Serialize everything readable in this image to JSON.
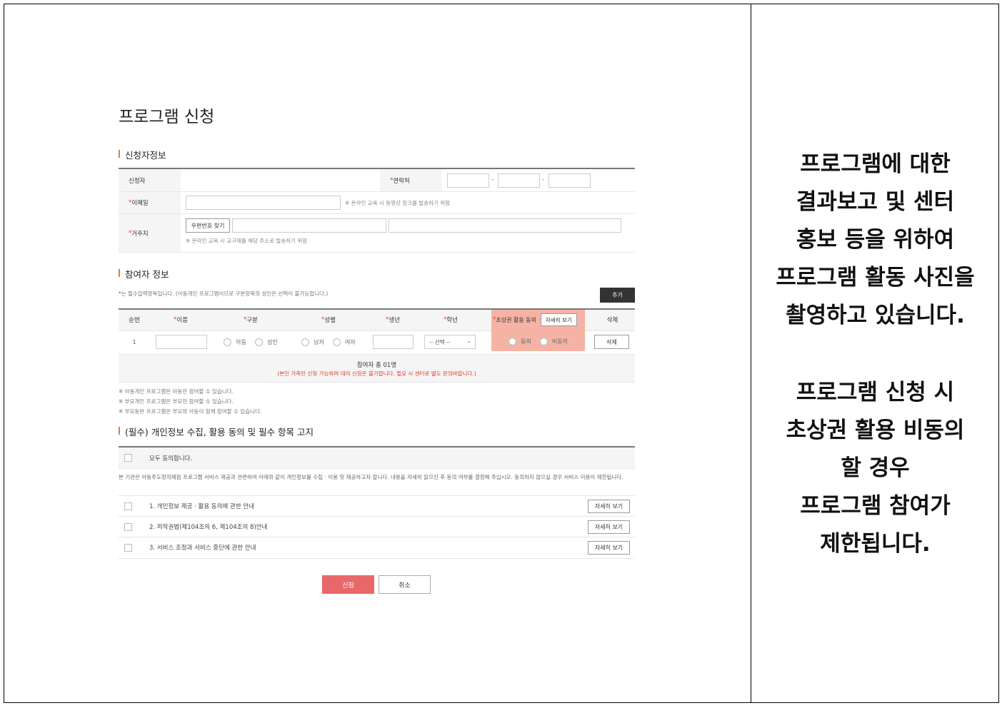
{
  "page_title": "프로그램 신청",
  "applicant": {
    "section_title": "신청자정보",
    "name_label": "신청자",
    "phone_label": "연락처",
    "email_label": "이메일",
    "email_hint": "※ 온라인 교육 시 동영상 링크를 발송하기 위함",
    "address_label": "거주지",
    "zip_button": "우편번호 찾기",
    "address_hint": "※ 온라인 교육 시 교구재를 해당 주소로 발송하기 위함",
    "phone_sep": "-"
  },
  "participant": {
    "section_title": "참여자 정보",
    "required_note": "는 필수입력항목입니다. (아동개인 프로그램이므로 구분항목의 성인은 선택이 불가능합니다.)",
    "add_button": "추가",
    "columns": [
      "순번",
      "이름",
      "구분",
      "성별",
      "생년",
      "학년",
      "초상권 활용 동의",
      "삭제"
    ],
    "detail_button": "자세히 보기",
    "row": {
      "number": "1",
      "type_options": [
        "아동",
        "성인"
      ],
      "gender_options": [
        "남자",
        "여자"
      ],
      "grade_select": "-- 선택 --",
      "consent_options": [
        "동의",
        "비동의"
      ],
      "delete_button": "삭제"
    },
    "total": "참여자 총 01명",
    "total_warning": "(본인 가족만 신청 가능하며 대리 신청은 불가합니다. 필요 시 센터로 별도 문의바랍니다.)",
    "notes": [
      "※ 아동개인 프로그램은 아동만 참여할 수 있습니다.",
      "※ 부모개인 프로그램은 부모만 참여할 수 있습니다.",
      "※ 부모동반 프로그램은 부모와 아동이 함께 참여할 수 있습니다."
    ]
  },
  "consent": {
    "section_title": "(필수) 개인정보 수집, 활용 동의 및 필수 항목 고지",
    "agree_all": "모두 동의합니다.",
    "intro": "본 기관은 아동주도창의체험 프로그램 서비스 제공과 관련하여 아래와 같이 개인정보를 수집 · 이용 및 제공하고자 합니다. 내용을 자세히 읽으신 후 동의 여부를 결정해 주십시오. 동의하지 않으실 경우 서비스 이용이 제한됩니다.",
    "items": [
      "1. 개인정보 제공 · 활용 동의에 관한 안내",
      "2. 저작권법(제104조의 6, 제104조의 8)안내",
      "3. 서비스 조정과 서비스 중단에 관한 안내"
    ],
    "detail_button": "자세히 보기"
  },
  "actions": {
    "submit": "신청",
    "cancel": "취소"
  },
  "side_note": {
    "part1": [
      "프로그램에 대한",
      "결과보고 및 센터",
      "홍보 등을 위하여",
      "프로그램 활동 사진을",
      "촬영하고 있습니다."
    ],
    "part2": [
      "프로그램 신청 시",
      "초상권 활용 비동의",
      "할 경우",
      "프로그램 참여가",
      "제한됩니다."
    ]
  },
  "colors": {
    "accent": "#e27a3f",
    "required": "#e23b2c",
    "submit": "#e8686a",
    "highlight": "#f5b3a6",
    "dark_button": "#333333"
  }
}
